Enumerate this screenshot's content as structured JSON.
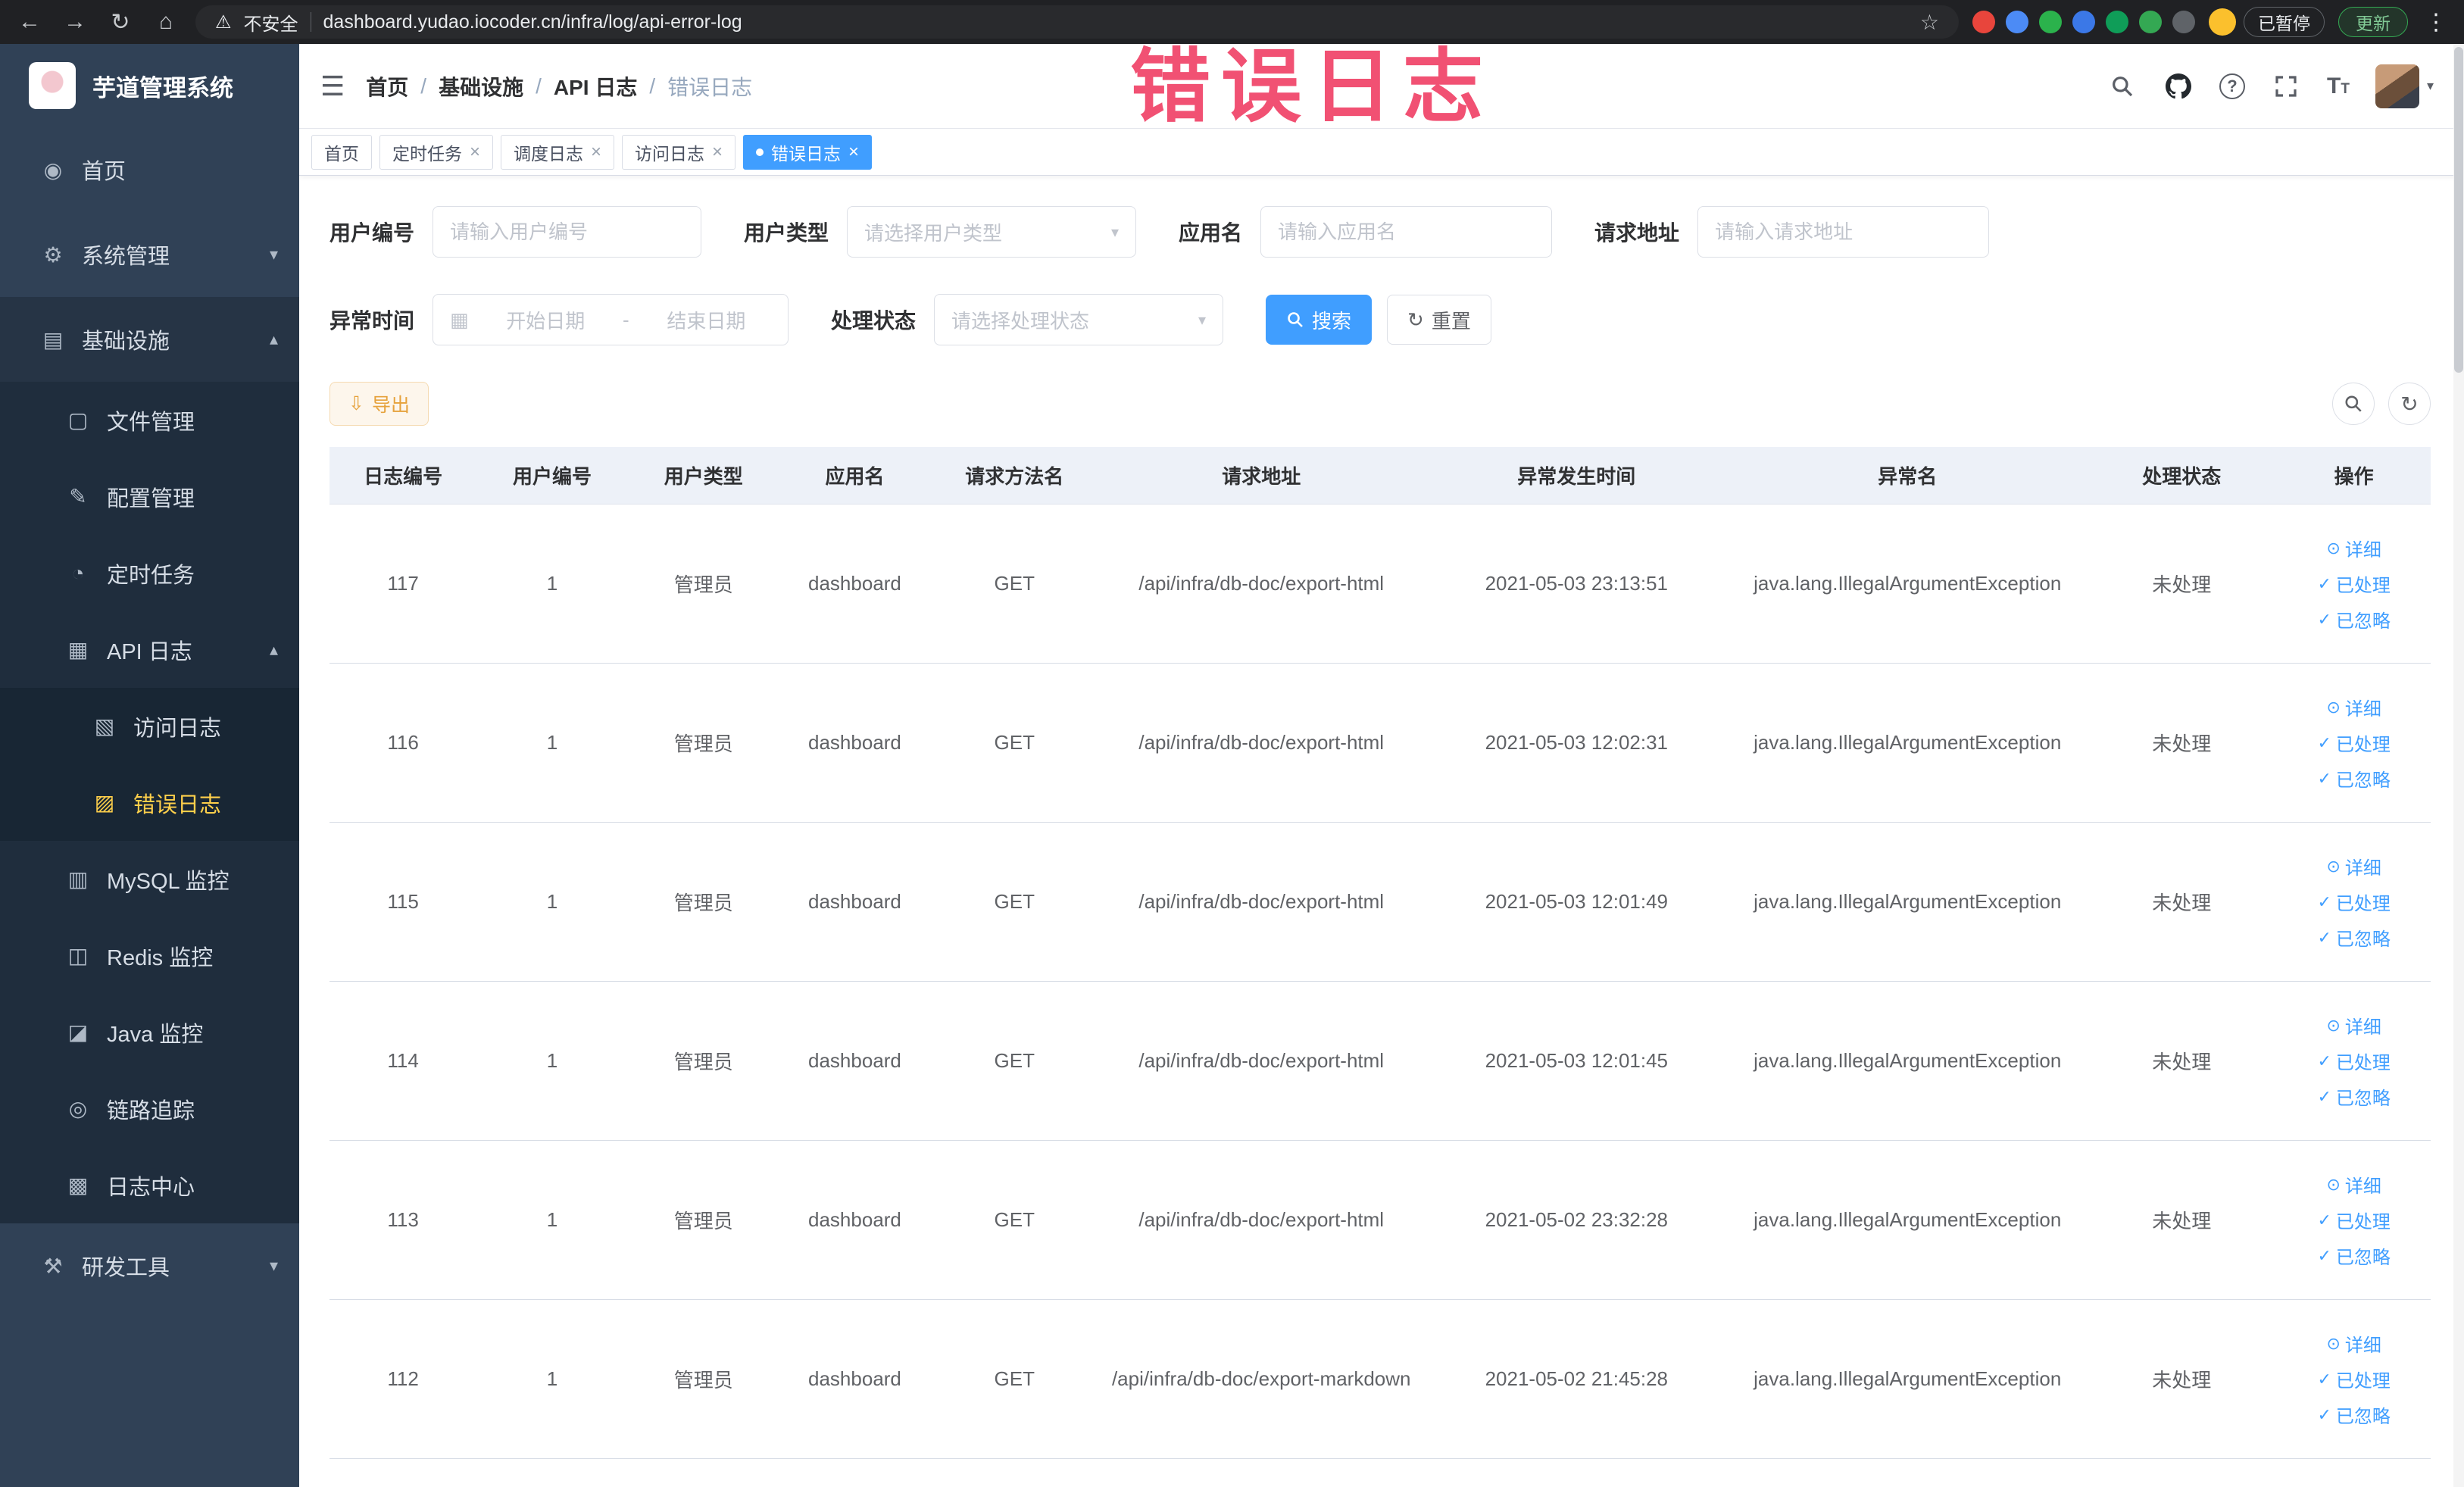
{
  "colors": {
    "primary": "#409eff",
    "warning": "#e6a23c",
    "sidebar_bg": "#304156",
    "sidebar_active": "#ffd04b",
    "active_tab_bg": "#409eff",
    "annotation": "#f03e64",
    "table_header_bg": "#edf1f8"
  },
  "annotation": {
    "text": "错误日志"
  },
  "browser": {
    "security_label": "不安全",
    "url": "dashboard.yudao.iocoder.cn/infra/log/api-error-log",
    "paused_badge": "已暂停",
    "update_button": "更新"
  },
  "sidebar": {
    "app_title": "芋道管理系统",
    "items": [
      {
        "label": "首页",
        "glyph": "◉",
        "icon": "dashboard-icon"
      },
      {
        "label": "系统管理",
        "glyph": "⚙",
        "icon": "gear-icon"
      },
      {
        "label": "基础设施",
        "glyph": "▤",
        "icon": "infrastructure-icon"
      },
      {
        "label": "文件管理",
        "glyph": "▢",
        "icon": "folder-icon"
      },
      {
        "label": "配置管理",
        "glyph": "✎",
        "icon": "config-icon"
      },
      {
        "label": "定时任务",
        "glyph": "◔",
        "icon": "timer-icon"
      },
      {
        "label": "API 日志",
        "glyph": "▦",
        "icon": "api-log-icon"
      },
      {
        "label": "访问日志",
        "glyph": "▧",
        "icon": "access-log-icon"
      },
      {
        "label": "错误日志",
        "glyph": "▨",
        "icon": "error-log-icon"
      },
      {
        "label": "MySQL 监控",
        "glyph": "▥",
        "icon": "mysql-icon"
      },
      {
        "label": "Redis 监控",
        "glyph": "◫",
        "icon": "redis-icon"
      },
      {
        "label": "Java 监控",
        "glyph": "◪",
        "icon": "java-icon"
      },
      {
        "label": "链路追踪",
        "glyph": "◎",
        "icon": "trace-icon"
      },
      {
        "label": "日志中心",
        "glyph": "▩",
        "icon": "log-center-icon"
      },
      {
        "label": "研发工具",
        "glyph": "⚒",
        "icon": "devtools-icon"
      }
    ]
  },
  "header": {
    "breadcrumbs": [
      "首页",
      "基础设施",
      "API 日志",
      "错误日志"
    ],
    "separator": "/"
  },
  "tabs": [
    {
      "label": "首页"
    },
    {
      "label": "定时任务"
    },
    {
      "label": "调度日志"
    },
    {
      "label": "访问日志"
    },
    {
      "label": "错误日志"
    }
  ],
  "filters": {
    "user_id": {
      "label": "用户编号",
      "placeholder": "请输入用户编号"
    },
    "user_type": {
      "label": "用户类型",
      "placeholder": "请选择用户类型"
    },
    "app_name": {
      "label": "应用名",
      "placeholder": "请输入应用名"
    },
    "request_url": {
      "label": "请求地址",
      "placeholder": "请输入请求地址"
    },
    "exception_time": {
      "label": "异常时间",
      "start_placeholder": "开始日期",
      "separator": "-",
      "end_placeholder": "结束日期"
    },
    "process_status": {
      "label": "处理状态",
      "placeholder": "请选择处理状态"
    },
    "search_label": "搜索",
    "reset_label": "重置"
  },
  "toolbar": {
    "export_label": "导出"
  },
  "table": {
    "columns": [
      "日志编号",
      "用户编号",
      "用户类型",
      "应用名",
      "请求方法名",
      "请求地址",
      "异常发生时间",
      "异常名",
      "处理状态",
      "操作"
    ],
    "row_actions": {
      "detail": "详细",
      "processed": "已处理",
      "ignored": "已忽略"
    },
    "rows": [
      {
        "log_id": "117",
        "user_id": "1",
        "user_type": "管理员",
        "app_name": "dashboard",
        "method": "GET",
        "url": "/api/infra/db-doc/export-html",
        "time": "2021-05-03 23:13:51",
        "exception": "java.lang.IllegalArgumentException",
        "status": "未处理"
      },
      {
        "log_id": "116",
        "user_id": "1",
        "user_type": "管理员",
        "app_name": "dashboard",
        "method": "GET",
        "url": "/api/infra/db-doc/export-html",
        "time": "2021-05-03 12:02:31",
        "exception": "java.lang.IllegalArgumentException",
        "status": "未处理"
      },
      {
        "log_id": "115",
        "user_id": "1",
        "user_type": "管理员",
        "app_name": "dashboard",
        "method": "GET",
        "url": "/api/infra/db-doc/export-html",
        "time": "2021-05-03 12:01:49",
        "exception": "java.lang.IllegalArgumentException",
        "status": "未处理"
      },
      {
        "log_id": "114",
        "user_id": "1",
        "user_type": "管理员",
        "app_name": "dashboard",
        "method": "GET",
        "url": "/api/infra/db-doc/export-html",
        "time": "2021-05-03 12:01:45",
        "exception": "java.lang.IllegalArgumentException",
        "status": "未处理"
      },
      {
        "log_id": "113",
        "user_id": "1",
        "user_type": "管理员",
        "app_name": "dashboard",
        "method": "GET",
        "url": "/api/infra/db-doc/export-html",
        "time": "2021-05-02 23:32:28",
        "exception": "java.lang.IllegalArgumentException",
        "status": "未处理"
      },
      {
        "log_id": "112",
        "user_id": "1",
        "user_type": "管理员",
        "app_name": "dashboard",
        "method": "GET",
        "url": "/api/infra/db-doc/export-markdown",
        "time": "2021-05-02 21:45:28",
        "exception": "java.lang.IllegalArgumentException",
        "status": "未处理"
      }
    ]
  },
  "icons": {
    "hamburger": "☰",
    "chevron_down": "▾",
    "chevron_up": "▴",
    "close": "×",
    "back": "←",
    "forward": "→",
    "reload": "↻",
    "home": "⌂",
    "warning": "⚠",
    "star": "☆",
    "menu_dots": "⋮",
    "download": "⇩",
    "calendar": "▦",
    "eye": "⊙",
    "check": "✓",
    "caret_down": "▾",
    "question": "?",
    "font_size_big": "T",
    "font_size_small": "T"
  }
}
